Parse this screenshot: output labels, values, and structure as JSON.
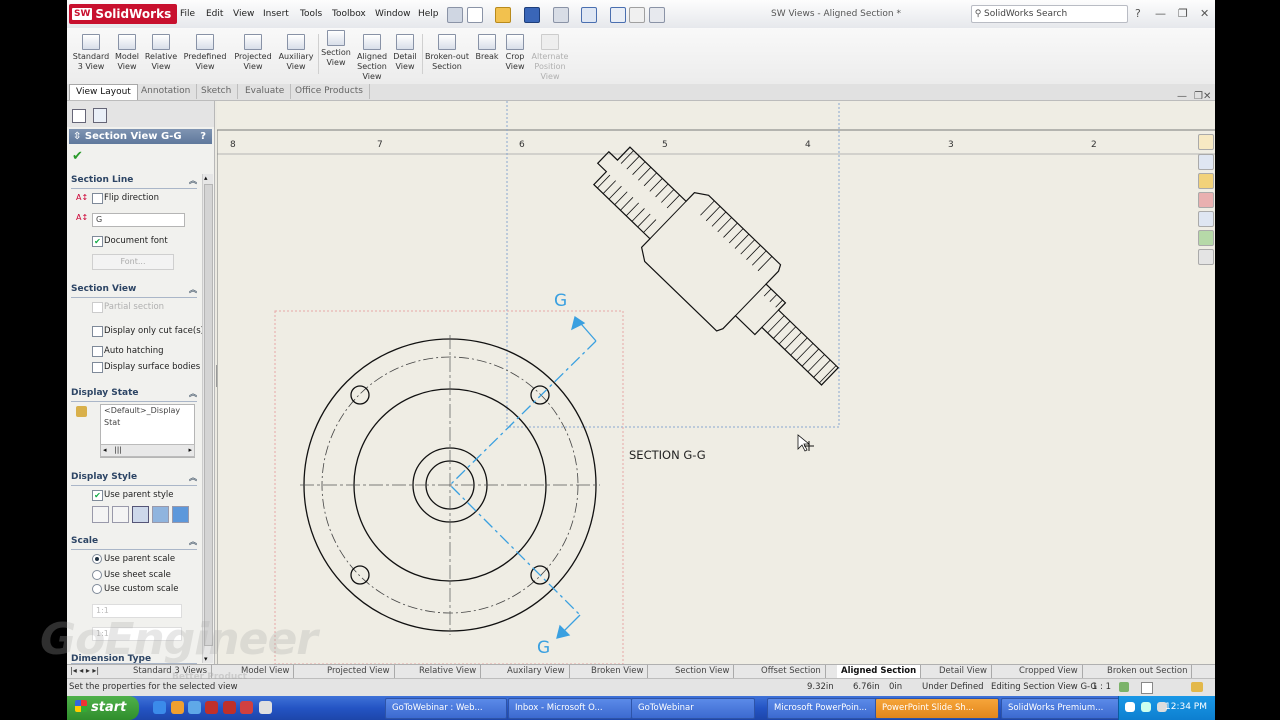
{
  "app": {
    "name": "SolidWorks",
    "logo_mark": "SW",
    "document_title": "SW Views - Aligned Section *",
    "menus": [
      "File",
      "Edit",
      "View",
      "Insert",
      "Tools",
      "Toolbox",
      "Window",
      "Help"
    ],
    "search_placeholder": "SolidWorks Search",
    "help_icon": "?",
    "minimize": "—",
    "restore": "❐",
    "close": "✕"
  },
  "ribbon": {
    "buttons": [
      {
        "label": "Standard 3 View",
        "enabled": true
      },
      {
        "label": "Model View",
        "enabled": true
      },
      {
        "label": "Relative View",
        "enabled": true
      },
      {
        "label": "Predefined View",
        "enabled": true
      },
      {
        "label": "Projected View",
        "enabled": true
      },
      {
        "label": "Auxiliary View",
        "enabled": true
      },
      {
        "label": "Section View",
        "enabled": true
      },
      {
        "label": "Aligned Section View",
        "enabled": true
      },
      {
        "label": "Detail View",
        "enabled": true
      },
      {
        "label": "Broken-out Section",
        "enabled": true
      },
      {
        "label": "Break",
        "enabled": true
      },
      {
        "label": "Crop View",
        "enabled": true
      },
      {
        "label": "Alternate Position View",
        "enabled": false
      }
    ]
  },
  "command_tabs": [
    "View Layout",
    "Annotation",
    "Sketch",
    "Evaluate",
    "Office Products"
  ],
  "active_tab": "View Layout",
  "property_manager": {
    "title": "Section View G-G",
    "help": "?",
    "ok_icon": "✔",
    "section_line": {
      "header": "Section Line",
      "flip_direction": "Flip direction",
      "flip_checked": false,
      "label_value": "G",
      "document_font": "Document font",
      "document_font_checked": true,
      "font_button": "Font..."
    },
    "section_view": {
      "header": "Section View",
      "partial_section": "Partial section",
      "display_only_cut": "Display only cut face(s)",
      "auto_hatching": "Auto hatching",
      "display_surface_bodies": "Display surface bodies"
    },
    "display_state": {
      "header": "Display State",
      "item": "<Default>_Display Stat"
    },
    "display_style": {
      "header": "Display Style",
      "use_parent_style": "Use parent style",
      "use_parent_checked": true
    },
    "scale": {
      "header": "Scale",
      "use_parent_scale": "Use parent scale",
      "use_sheet_scale": "Use sheet scale",
      "use_custom_scale": "Use custom scale",
      "selected": "Use parent scale",
      "custom_value": "1:1"
    },
    "dimension_type": {
      "header": "Dimension Type"
    }
  },
  "drawing": {
    "border_numbers": [
      "8",
      "7",
      "6",
      "5",
      "4",
      "3",
      "2"
    ],
    "section_letter": "G",
    "section_label": "SECTION G-G"
  },
  "sheet_tabs": [
    "Standard 3 Views",
    "Model View",
    "Projected View",
    "Relative View",
    "Auxilary View",
    "Broken View",
    "Section View",
    "Offset Section",
    "Aligned Section",
    "Detail View",
    "Cropped View",
    "Broken out Section"
  ],
  "active_sheet": "Aligned Section",
  "status_bar": {
    "message": "Set the properties for the selected view",
    "x": "9.32in",
    "y": "6.76in",
    "z": "0in",
    "state": "Under Defined",
    "editing": "Editing Section View G-G",
    "scale": "1 : 1"
  },
  "watermark": {
    "text": "GoEngineer",
    "sub": "Better Product"
  },
  "taskbar": {
    "start": "start",
    "tasks": [
      {
        "label": "GoToWebinar : Web...",
        "active": false
      },
      {
        "label": "Inbox - Microsoft O...",
        "active": false
      },
      {
        "label": "GoToWebinar",
        "active": false
      },
      {
        "label": "Microsoft PowerPoin...",
        "active": false
      },
      {
        "label": "PowerPoint Slide Sh...",
        "active": true
      },
      {
        "label": "SolidWorks Premium...",
        "active": false
      }
    ],
    "clock": "12:34 PM"
  },
  "colors": {
    "accent": "#5f789c",
    "section_line": "#3aa0e0",
    "canvas": "#efede4"
  }
}
